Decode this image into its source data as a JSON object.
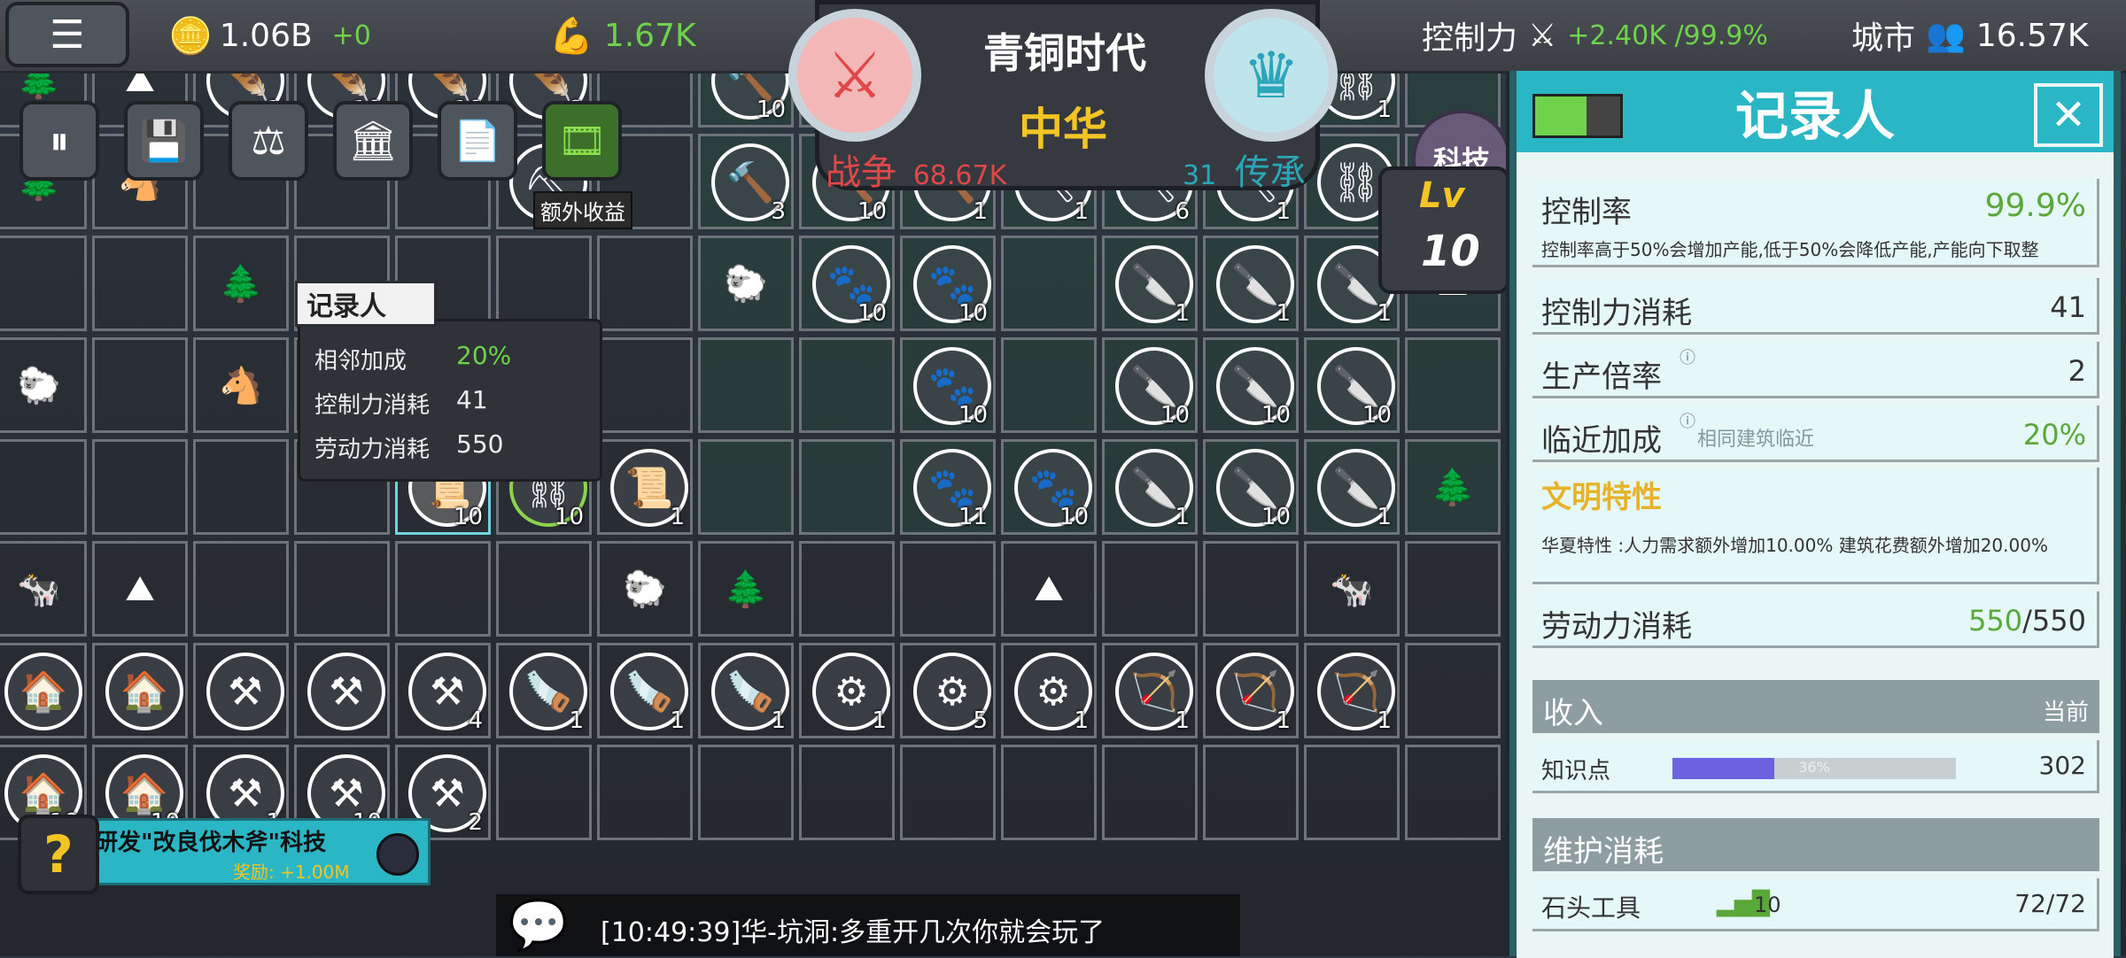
{
  "top": {
    "gold": "1.06B",
    "gold_delta": "+0",
    "power": "1.67K",
    "era": "青铜时代",
    "civ": "中华",
    "war_label": "战争",
    "war_value": "68.67K",
    "legacy_label": "传承",
    "legacy_value": "31",
    "control_label": "控制力",
    "control_value": "+2.40K /99.9%",
    "city_label": "城市",
    "city_value": "16.57K",
    "tech_label": "科技",
    "lv_label": "Lv",
    "lv_value": "10",
    "extra_income": "额外收益"
  },
  "tooltip": {
    "title": "记录人",
    "rows": [
      {
        "label": "相邻加成",
        "value": "20%"
      },
      {
        "label": "控制力消耗",
        "value": "41"
      },
      {
        "label": "劳动力消耗",
        "value": "550"
      }
    ]
  },
  "panel": {
    "title": "记录人",
    "control_rate_label": "控制率",
    "control_rate_value": "99.9%",
    "control_rate_desc": "控制率高于50%会增加产能,低于50%会降低产能,产能向下取整",
    "control_cost_label": "控制力消耗",
    "control_cost_value": "41",
    "prod_mult_label": "生产倍率",
    "prod_mult_value": "2",
    "adj_label": "临近加成",
    "adj_desc": "相同建筑临近",
    "adj_value": "20%",
    "civ_trait_label": "文明特性",
    "civ_trait_desc": "华夏特性 :人力需求额外增加10.00% 建筑花费额外增加20.00%",
    "labor_label": "劳动力消耗",
    "labor_used": "550",
    "labor_total": "/550",
    "income_label": "收入",
    "income_current": "当前",
    "knowledge_label": "知识点",
    "knowledge_progress": "36%",
    "knowledge_progress_fraction": 0.36,
    "knowledge_value": "302",
    "upkeep_label": "维护消耗",
    "stone_tool_label": "石头工具",
    "stone_tool_count": "10",
    "stone_tool_value": "72/72"
  },
  "quest": {
    "text": "研发\"改良伐木斧\"科技",
    "reward": "奖励: +1.00M"
  },
  "chat": {
    "message": "[10:49:39]华-坑洞:多重开几次你就会玩了"
  },
  "grid": {
    "rows": [
      [
        null,
        null,
        {
          "i": "🪶",
          "n": "1"
        },
        {
          "i": "🪶",
          "n": "10"
        },
        {
          "i": "🪶",
          "n": "10"
        },
        {
          "i": "🪶",
          "n": "2"
        },
        null,
        {
          "i": "🔨",
          "n": "10"
        },
        {
          "i": "🔨",
          "n": "10"
        },
        {
          "i": "🔨",
          "n": "10"
        },
        {
          "i": "⛏",
          "n": "1"
        },
        {
          "i": "⛏",
          "n": "10"
        },
        {
          "i": "⛏",
          "n": "1"
        },
        {
          "i": "⛓",
          "n": "1"
        },
        null
      ],
      [
        null,
        null,
        null,
        null,
        null,
        {
          "i": "⛏",
          "n": ""
        },
        null,
        {
          "i": "🔨",
          "n": "3"
        },
        {
          "i": "🔨",
          "n": "10"
        },
        {
          "i": "🔨",
          "n": "1"
        },
        {
          "i": "⛏",
          "n": "1"
        },
        {
          "i": "⛏",
          "n": "6"
        },
        {
          "i": "⛏",
          "n": "1"
        },
        {
          "i": "⛓",
          "n": "1"
        },
        {
          "i": "⛓",
          "n": "2"
        }
      ],
      [
        null,
        null,
        null,
        null,
        null,
        null,
        null,
        null,
        {
          "i": "🐾",
          "n": "10"
        },
        {
          "i": "🐾",
          "n": "10"
        },
        null,
        {
          "i": "🔪",
          "n": "1"
        },
        {
          "i": "🔪",
          "n": "1"
        },
        {
          "i": "🔪",
          "n": "1"
        },
        null
      ],
      [
        null,
        null,
        null,
        null,
        null,
        null,
        null,
        null,
        null,
        {
          "i": "🐾",
          "n": "10"
        },
        null,
        {
          "i": "🔪",
          "n": "10"
        },
        {
          "i": "🔪",
          "n": "10"
        },
        {
          "i": "🔪",
          "n": "10"
        },
        null
      ],
      [
        null,
        null,
        null,
        null,
        {
          "i": "📜",
          "n": "10",
          "sel": true
        },
        {
          "i": "⛓",
          "n": "10",
          "green": true
        },
        {
          "i": "📜",
          "n": "1"
        },
        null,
        null,
        {
          "i": "🐾",
          "n": "11"
        },
        {
          "i": "🐾",
          "n": "10"
        },
        {
          "i": "🔪",
          "n": "1"
        },
        {
          "i": "🔪",
          "n": "10"
        },
        {
          "i": "🔪",
          "n": "1"
        },
        null
      ],
      [
        null,
        null,
        null,
        null,
        null,
        null,
        null,
        null,
        null,
        null,
        null,
        null,
        null,
        null,
        null
      ],
      [
        {
          "i": "🏠",
          "n": ""
        },
        {
          "i": "🏠",
          "n": ""
        },
        {
          "i": "⚒",
          "n": ""
        },
        {
          "i": "⚒",
          "n": ""
        },
        {
          "i": "⚒",
          "n": "4"
        },
        {
          "i": "🪚",
          "n": "1"
        },
        {
          "i": "🪚",
          "n": "1"
        },
        {
          "i": "🪚",
          "n": "1"
        },
        {
          "i": "⚙",
          "n": "1"
        },
        {
          "i": "⚙",
          "n": "5"
        },
        {
          "i": "⚙",
          "n": "1"
        },
        {
          "i": "🏹",
          "n": "1"
        },
        {
          "i": "🏹",
          "n": "1"
        },
        {
          "i": "🏹",
          "n": "1"
        },
        null
      ],
      [
        {
          "i": "🏠",
          "n": "10"
        },
        {
          "i": "🏠",
          "n": "10"
        },
        {
          "i": "⚒",
          "n": "1"
        },
        {
          "i": "⚒",
          "n": "10"
        },
        {
          "i": "⚒",
          "n": "2"
        },
        null,
        null,
        null,
        null,
        null,
        null,
        null,
        null,
        null,
        null
      ]
    ],
    "decor": [
      {
        "r": 0,
        "c": 0,
        "i": "🌲"
      },
      {
        "r": 0,
        "c": 1,
        "i": "⛰"
      },
      {
        "r": 1,
        "c": 0,
        "i": "🌲"
      },
      {
        "r": 1,
        "c": 1,
        "i": "🐴"
      },
      {
        "r": 2,
        "c": 2,
        "i": "🌲"
      },
      {
        "r": 2,
        "c": 7,
        "i": "🐑"
      },
      {
        "r": 2,
        "c": 14,
        "i": "⛰"
      },
      {
        "r": 3,
        "c": 0,
        "i": "🐑"
      },
      {
        "r": 3,
        "c": 2,
        "i": "🐴"
      },
      {
        "r": 3,
        "c": 3,
        "i": "🌲"
      },
      {
        "r": 3,
        "c": 4,
        "i": "🏛"
      },
      {
        "r": 3,
        "c": 5,
        "i": "⚖"
      },
      {
        "r": 4,
        "c": 14,
        "i": "🌲"
      },
      {
        "r": 5,
        "c": 0,
        "i": "🐄"
      },
      {
        "r": 5,
        "c": 1,
        "i": "⛰"
      },
      {
        "r": 5,
        "c": 6,
        "i": "🐑"
      },
      {
        "r": 5,
        "c": 7,
        "i": "🌲"
      },
      {
        "r": 5,
        "c": 10,
        "i": "⛰"
      },
      {
        "r": 5,
        "c": 13,
        "i": "🐄"
      }
    ]
  }
}
